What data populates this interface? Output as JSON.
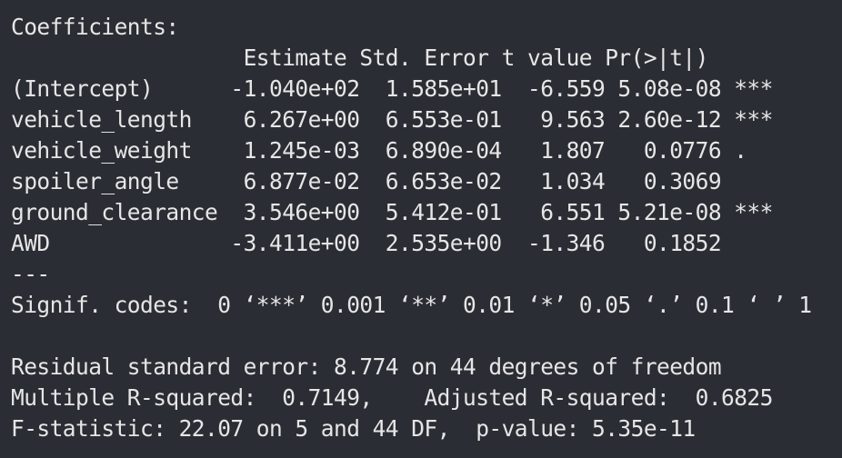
{
  "console": {
    "lines": [
      "Coefficients:",
      "                  Estimate Std. Error t value Pr(>|t|)    ",
      "(Intercept)      -1.040e+02  1.585e+01  -6.559 5.08e-08 ***",
      "vehicle_length    6.267e+00  6.553e-01   9.563 2.60e-12 ***",
      "vehicle_weight    1.245e-03  6.890e-04   1.807   0.0776 .  ",
      "spoiler_angle     6.877e-02  6.653e-02   1.034   0.3069    ",
      "ground_clearance  3.546e+00  5.412e-01   6.551 5.21e-08 ***",
      "AWD              -3.411e+00  2.535e+00  -1.346   0.1852    ",
      "---",
      "Signif. codes:  0 ‘***’ 0.001 ‘**’ 0.01 ‘*’ 0.05 ‘.’ 0.1 ‘ ’ 1",
      "",
      "Residual standard error: 8.774 on 44 degrees of freedom",
      "Multiple R-squared:  0.7149,    Adjusted R-squared:  0.6825 ",
      "F-statistic: 22.07 on 5 and 44 DF,  p-value: 5.35e-11"
    ]
  }
}
